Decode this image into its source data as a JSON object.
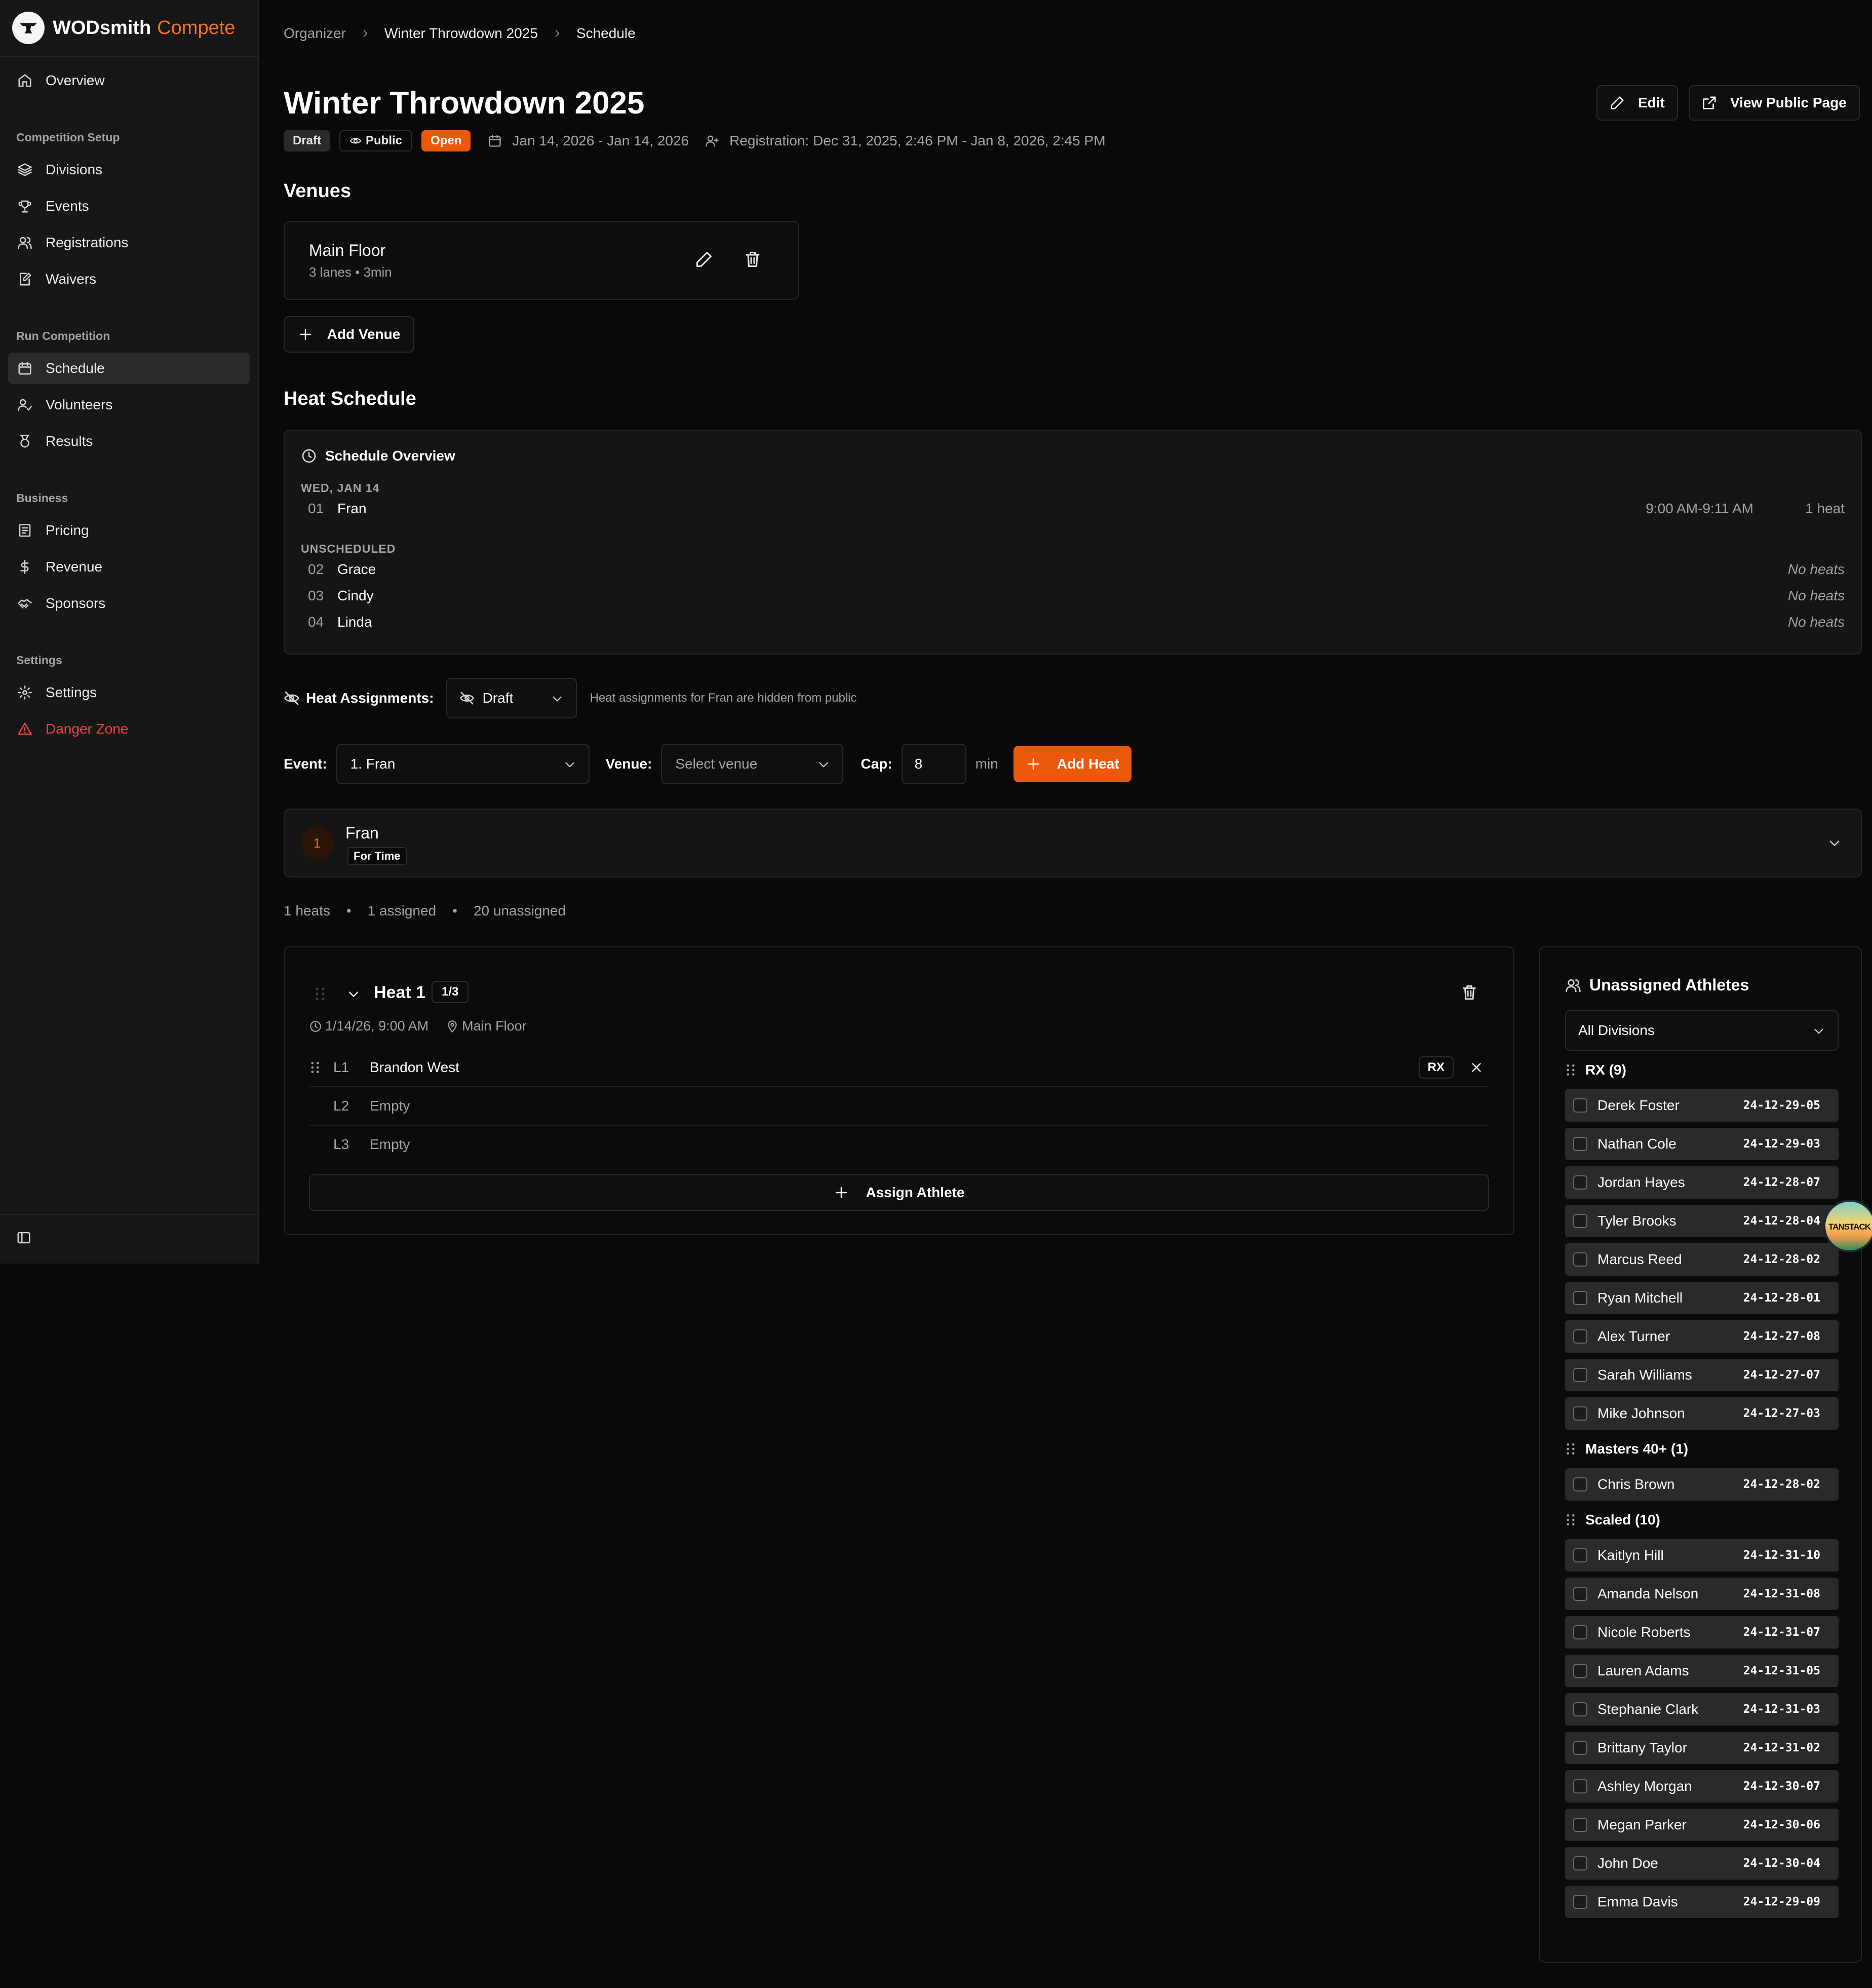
{
  "brand": {
    "name_bold": "WODsmith",
    "name_accent": "Compete"
  },
  "sidebar": {
    "overview": "Overview",
    "groups": {
      "setup": "Competition Setup",
      "run": "Run Competition",
      "business": "Business",
      "settings": "Settings"
    },
    "items": {
      "divisions": "Divisions",
      "events": "Events",
      "registrations": "Registrations",
      "waivers": "Waivers",
      "schedule": "Schedule",
      "volunteers": "Volunteers",
      "results": "Results",
      "pricing": "Pricing",
      "revenue": "Revenue",
      "sponsors": "Sponsors",
      "settings": "Settings",
      "danger": "Danger Zone"
    },
    "active": "schedule"
  },
  "breadcrumb": [
    "Organizer",
    "Winter Throwdown 2025",
    "Schedule"
  ],
  "header": {
    "title": "Winter Throwdown 2025",
    "edit": "Edit",
    "view_public": "View Public Page",
    "badges": {
      "draft": "Draft",
      "public": "Public",
      "open": "Open"
    },
    "dates": "Jan 14, 2026 - Jan 14, 2026",
    "registration": "Registration: Dec 31, 2025, 2:46 PM - Jan 8, 2026, 2:45 PM"
  },
  "venues": {
    "title": "Venues",
    "items": [
      {
        "name": "Main Floor",
        "sub": "3 lanes • 3min"
      }
    ],
    "add": "Add Venue"
  },
  "heat_schedule": {
    "title": "Heat Schedule",
    "overview": {
      "title": "Schedule Overview",
      "scheduled_label": "WED, JAN 14",
      "scheduled": [
        {
          "num": "01",
          "name": "Fran",
          "time": "9:00 AM-9:11 AM",
          "heats": "1 heat"
        }
      ],
      "unscheduled_label": "UNSCHEDULED",
      "unscheduled": [
        {
          "num": "02",
          "name": "Grace",
          "status": "No heats"
        },
        {
          "num": "03",
          "name": "Cindy",
          "status": "No heats"
        },
        {
          "num": "04",
          "name": "Linda",
          "status": "No heats"
        }
      ]
    }
  },
  "heat_assignments": {
    "label": "Heat Assignments:",
    "state": "Draft",
    "note": "Heat assignments for Fran are hidden from public"
  },
  "filters": {
    "event_label": "Event:",
    "event_value": "1. Fran",
    "venue_label": "Venue:",
    "venue_placeholder": "Select venue",
    "cap_label": "Cap:",
    "cap_value": "8",
    "cap_unit": "min",
    "add_heat": "Add Heat"
  },
  "event": {
    "num": "1",
    "name": "Fran",
    "type": "For Time"
  },
  "stats": {
    "heats": "1 heats",
    "assigned": "1 assigned",
    "unassigned": "20 unassigned",
    "dot": "•"
  },
  "heat": {
    "title": "Heat 1",
    "count": "1/3",
    "datetime": "1/14/26, 9:00 AM",
    "venue": "Main Floor",
    "lanes": [
      {
        "lane": "L1",
        "athlete": "Brandon West",
        "division": "RX"
      },
      {
        "lane": "L2",
        "athlete": "Empty"
      },
      {
        "lane": "L3",
        "athlete": "Empty"
      }
    ],
    "assign": "Assign Athlete"
  },
  "unassigned": {
    "title": "Unassigned Athletes",
    "filter": "All Divisions",
    "groups": [
      {
        "name": "RX (9)",
        "athletes": [
          {
            "name": "Derek Foster",
            "date": "24-12-29-05"
          },
          {
            "name": "Nathan Cole",
            "date": "24-12-29-03"
          },
          {
            "name": "Jordan Hayes",
            "date": "24-12-28-07"
          },
          {
            "name": "Tyler Brooks",
            "date": "24-12-28-04"
          },
          {
            "name": "Marcus Reed",
            "date": "24-12-28-02"
          },
          {
            "name": "Ryan Mitchell",
            "date": "24-12-28-01"
          },
          {
            "name": "Alex Turner",
            "date": "24-12-27-08"
          },
          {
            "name": "Sarah Williams",
            "date": "24-12-27-07"
          },
          {
            "name": "Mike Johnson",
            "date": "24-12-27-03"
          }
        ]
      },
      {
        "name": "Masters 40+ (1)",
        "athletes": [
          {
            "name": "Chris Brown",
            "date": "24-12-28-02"
          }
        ]
      },
      {
        "name": "Scaled (10)",
        "athletes": [
          {
            "name": "Kaitlyn Hill",
            "date": "24-12-31-10"
          },
          {
            "name": "Amanda Nelson",
            "date": "24-12-31-08"
          },
          {
            "name": "Nicole Roberts",
            "date": "24-12-31-07"
          },
          {
            "name": "Lauren Adams",
            "date": "24-12-31-05"
          },
          {
            "name": "Stephanie Clark",
            "date": "24-12-31-03"
          },
          {
            "name": "Brittany Taylor",
            "date": "24-12-31-02"
          },
          {
            "name": "Ashley Morgan",
            "date": "24-12-30-07"
          },
          {
            "name": "Megan Parker",
            "date": "24-12-30-06"
          },
          {
            "name": "John Doe",
            "date": "24-12-30-04"
          },
          {
            "name": "Emma Davis",
            "date": "24-12-29-09"
          }
        ]
      }
    ]
  },
  "devtools": {
    "label": "TANSTACK"
  },
  "colors": {
    "accent": "#ea580c",
    "danger": "#ef4444",
    "background": "#0a0909",
    "sidebar": "#171717"
  }
}
